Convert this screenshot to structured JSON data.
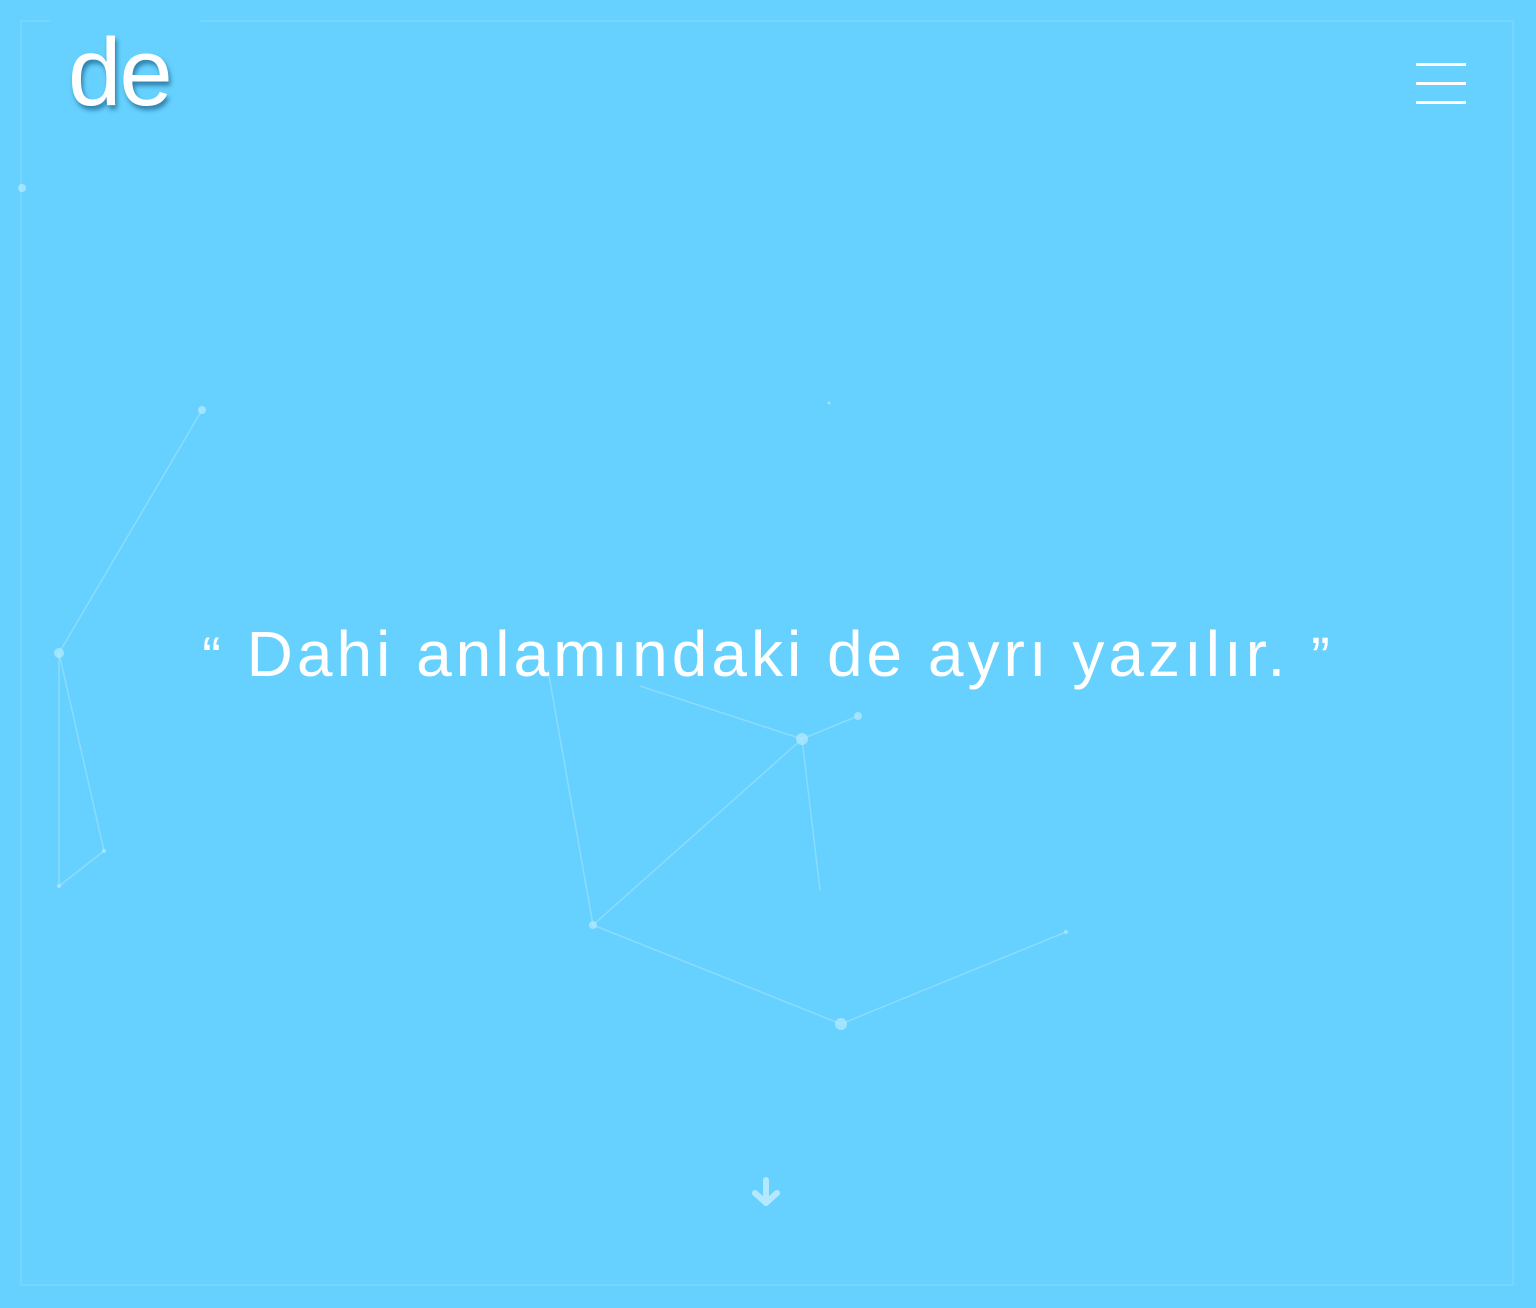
{
  "header": {
    "logo_text": "de",
    "menu_label": "menu"
  },
  "hero": {
    "quote_open": "“",
    "quote_text": "Dahi anlamındaki de ayrı yazılır.",
    "quote_close": "”"
  },
  "icons": {
    "menu": "hamburger-icon",
    "scroll": "arrow-down-icon"
  },
  "colors": {
    "background": "#66d1fe",
    "text": "#ffffff",
    "network_lines": "#a8e6ff",
    "scroll_arrow": "#b4e8ff"
  }
}
